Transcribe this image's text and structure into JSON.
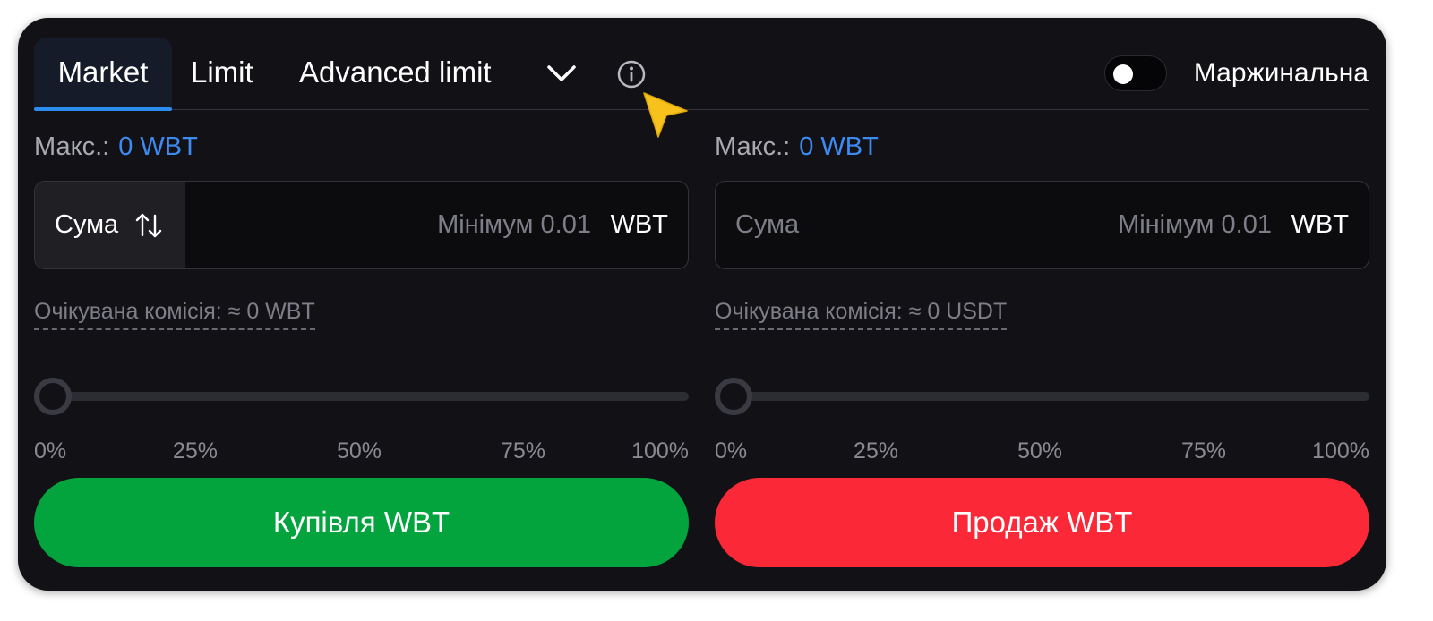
{
  "tabs": {
    "market": "Market",
    "limit": "Limit",
    "advanced": "Advanced limit"
  },
  "margin": {
    "label": "Маржинальна",
    "enabled": false
  },
  "icons": {
    "dropdown": "chevron-down-icon",
    "info": "info-icon",
    "swap": "swap-vertical-icon",
    "cursor": "cursor-pointer-icon"
  },
  "buy": {
    "max_label": "Макс.:",
    "max_value": "0 WBT",
    "amount_label": "Сума",
    "min_text": "Мінімум 0.01",
    "unit": "WBT",
    "fee": "Очікувана комісія: ≈ 0 WBT",
    "slider_value": 0,
    "marks": [
      "0%",
      "25%",
      "50%",
      "75%",
      "100%"
    ],
    "button": "Купівля WBT"
  },
  "sell": {
    "max_label": "Макс.:",
    "max_value": "0 WBT",
    "amount_placeholder": "Сума",
    "min_text": "Мінімум 0.01",
    "unit": "WBT",
    "fee": "Очікувана комісія: ≈ 0 USDT",
    "slider_value": 0,
    "marks": [
      "0%",
      "25%",
      "50%",
      "75%",
      "100%"
    ],
    "button": "Продаж WBT"
  },
  "colors": {
    "background": "#121216",
    "accent": "#3d8bf2",
    "buy": "#03a43e",
    "sell": "#fb2838",
    "cursor": "#f7c21b"
  }
}
